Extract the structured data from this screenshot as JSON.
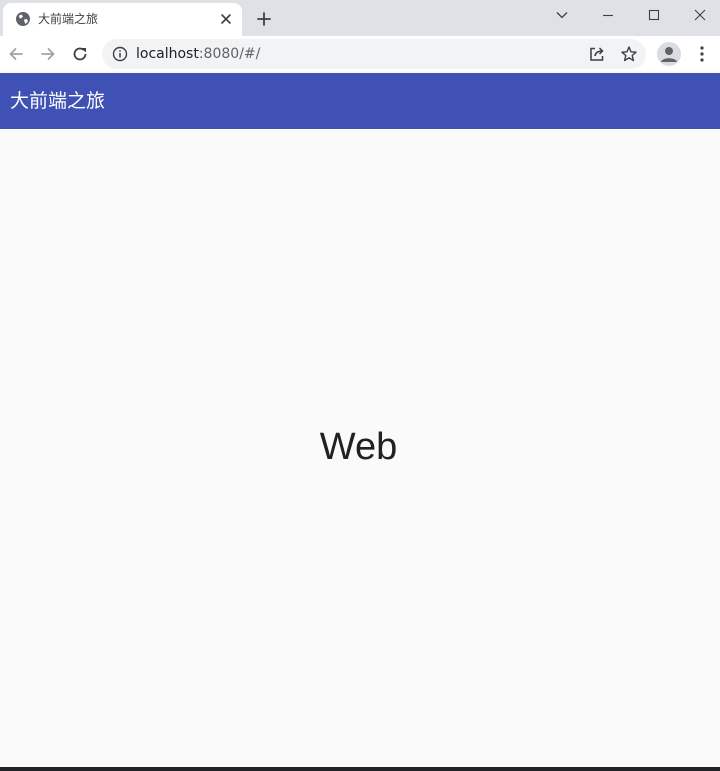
{
  "browser": {
    "tab": {
      "title": "大前端之旅",
      "favicon": "globe-icon"
    },
    "address": {
      "host": "localhost",
      "path": ":8080/#/"
    }
  },
  "app": {
    "title": "大前端之旅",
    "primary_color": "#3f51b5"
  },
  "main": {
    "text": "Web"
  }
}
